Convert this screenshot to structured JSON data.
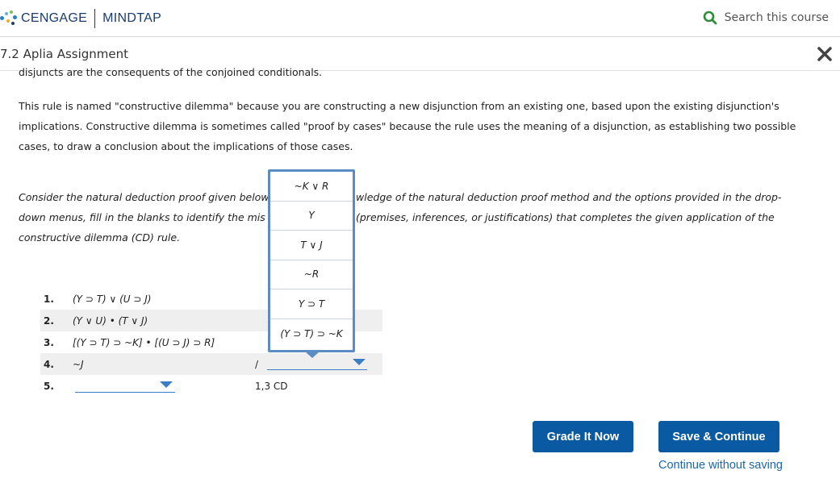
{
  "header": {
    "brand": "CENGAGE",
    "product": "MINDTAP",
    "search_placeholder": "Search this course"
  },
  "assignment": {
    "title": "7.2 Aplia Assignment"
  },
  "content": {
    "partial_line": "disjuncts are the consequents of the conjoined conditionals.",
    "paragraph1": "This rule is named \"constructive dilemma\" because you are constructing a new disjunction from an existing one, based upon the existing disjunction's implications. Constructive dilemma is sometimes called \"proof by cases\" because the rule uses the meaning of a disjunction, as establishing two possible cases, to draw a conclusion about the implications of those cases.",
    "instruction_part1": "Consider the natural deduction proof given below",
    "instruction_part2": "wledge of the natural deduction proof method and the options provided in the drop-",
    "instruction_part3": "down menus, fill in the blanks to identify the mis",
    "instruction_part4": "(premises, inferences, or justifications) that completes the given application of the",
    "instruction_part5": "constructive dilemma (CD) rule."
  },
  "proof": {
    "lines": [
      {
        "num": "1.",
        "expr": "(Y ⊃ T) ∨ (U ⊃ J)",
        "just": ""
      },
      {
        "num": "2.",
        "expr": "(Y ∨ U) • (T ∨ J)",
        "just": ""
      },
      {
        "num": "3.",
        "expr": "[(Y ⊃ T) ⊃ ~K] • [(U ⊃ J) ⊃ R]",
        "just": ""
      },
      {
        "num": "4.",
        "expr": "~J",
        "just": "/"
      },
      {
        "num": "5.",
        "expr": "",
        "just": "1,3 CD"
      }
    ]
  },
  "dropdown": {
    "options": [
      "~K ∨ R",
      "Y",
      "T ∨ J",
      "~R",
      "Y ⊃ T",
      "(Y ⊃ T) ⊃ ~K"
    ]
  },
  "buttons": {
    "grade": "Grade It Now",
    "save": "Save & Continue",
    "continue_link": "Continue without saving"
  },
  "colors": {
    "primary": "#0a5aa3",
    "link": "#1a66b0",
    "dropdown_border": "#5b8dc4",
    "search_icon": "#2e8b3a"
  }
}
